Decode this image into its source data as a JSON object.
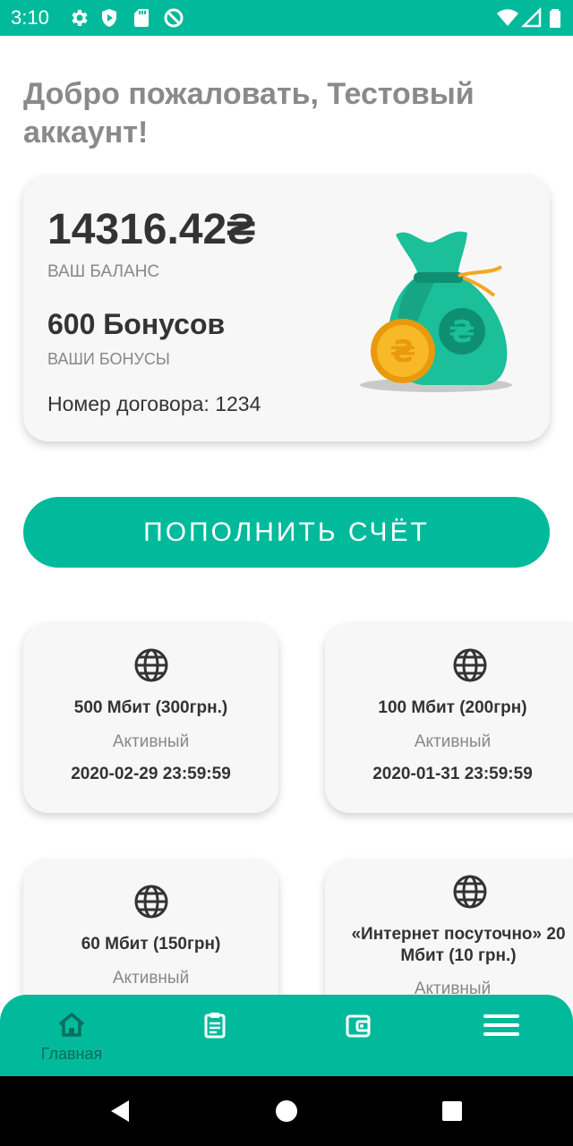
{
  "status_bar": {
    "time": "3:10",
    "icons": [
      "settings-icon",
      "shield-play-icon",
      "sd-card-icon",
      "no-sync-icon",
      "wifi-icon",
      "signal-icon",
      "battery-icon"
    ]
  },
  "greeting": "Добро пожаловать, Тестовый аккаунт!",
  "balance_card": {
    "amount": "14316.42₴",
    "amount_label": "ВАШ БАЛАНС",
    "bonuses": "600 Бонусов",
    "bonuses_label": "ВАШИ БОНУСЫ",
    "contract": "Номер договора: 1234",
    "image": "money-bag-icon"
  },
  "topup_button": "ПОПОЛНИТЬ СЧЁТ",
  "tariffs": [
    {
      "name": "500 Мбит (300грн.)",
      "status": "Активный",
      "date": "2020-02-29 23:59:59",
      "icon": "globe-icon"
    },
    {
      "name": "100 Мбит (200грн)",
      "status": "Активный",
      "date": "2020-01-31 23:59:59",
      "icon": "globe-icon"
    },
    {
      "name": "60 Мбит (150грн)",
      "status": "Активный",
      "date": "",
      "icon": "globe-icon"
    },
    {
      "name": "«Интернет посуточно» 20 Мбит (10 грн.)",
      "status": "Активный",
      "date": "",
      "icon": "globe-icon"
    }
  ],
  "bottom_nav": {
    "items": [
      {
        "label": "Главная",
        "icon": "home-icon",
        "active": true
      },
      {
        "label": "",
        "icon": "clipboard-icon",
        "active": false
      },
      {
        "label": "",
        "icon": "wallet-icon",
        "active": false
      },
      {
        "label": "",
        "icon": "menu-icon",
        "active": false
      }
    ]
  },
  "colors": {
    "accent": "#00BA9B",
    "text_dark": "#333333",
    "text_muted": "#888888",
    "greeting": "#8A8A8A",
    "card_bg": "#F7F7F7",
    "nav_active": "#0C6D5E"
  }
}
